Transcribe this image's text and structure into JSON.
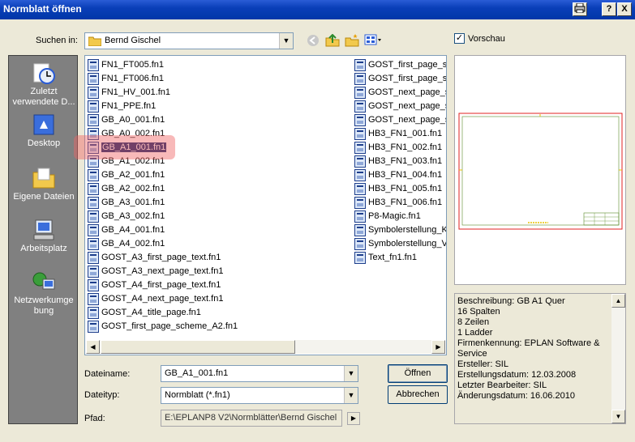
{
  "window": {
    "title": "Normblatt öffnen",
    "help_label": "?",
    "close_label": "X"
  },
  "lookin": {
    "label": "Suchen in:",
    "value": "Bernd Gischel"
  },
  "preview_checkbox": {
    "label": "Vorschau",
    "checked_mark": "✓"
  },
  "places": [
    {
      "label1": "Zuletzt",
      "label2": "verwendete D..."
    },
    {
      "label1": "Desktop",
      "label2": ""
    },
    {
      "label1": "Eigene Dateien",
      "label2": ""
    },
    {
      "label1": "Arbeitsplatz",
      "label2": ""
    },
    {
      "label1": "Netzwerkumge",
      "label2": "bung"
    }
  ],
  "files_col1": [
    "FN1_FT005.fn1",
    "FN1_FT006.fn1",
    "FN1_HV_001.fn1",
    "FN1_PPE.fn1",
    "GB_A0_001.fn1",
    "GB_A0_002.fn1",
    "GB_A1_001.fn1",
    "GB_A1_002.fn1",
    "GB_A2_001.fn1",
    "GB_A2_002.fn1",
    "GB_A3_001.fn1",
    "GB_A3_002.fn1",
    "GB_A4_001.fn1",
    "GB_A4_002.fn1",
    "GOST_A3_first_page_text.fn1",
    "GOST_A3_next_page_text.fn1",
    "GOST_A4_first_page_text.fn1",
    "GOST_A4_next_page_text.fn1",
    "GOST_A4_title_page.fn1",
    "GOST_first_page_scheme_A2.fn1"
  ],
  "files_col2": [
    "GOST_first_page_sc",
    "GOST_first_page_sc",
    "GOST_next_page_sc",
    "GOST_next_page_sc",
    "GOST_next_page_sc",
    "HB3_FN1_001.fn1",
    "HB3_FN1_002.fn1",
    "HB3_FN1_003.fn1",
    "HB3_FN1_004.fn1",
    "HB3_FN1_005.fn1",
    "HB3_FN1_006.fn1",
    "P8-Magic.fn1",
    "Symbolerstellung_Kle",
    "Symbolerstellung_Ve",
    "Text_fn1.fn1"
  ],
  "filename": {
    "label": "Dateiname:",
    "value": "GB_A1_001.fn1"
  },
  "filetype": {
    "label": "Dateityp:",
    "value": "Normblatt (*.fn1)"
  },
  "path": {
    "label": "Pfad:",
    "value": "E:\\EPLANP8 V2\\Normblätter\\Bernd Gischel"
  },
  "buttons": {
    "open": "Öffnen",
    "cancel": "Abbrechen"
  },
  "info_lines": [
    "Beschreibung: GB A1 Quer",
    "16 Spalten",
    "8 Zeilen",
    "1 Ladder",
    "Firmenkennung: EPLAN Software &",
    "Service",
    "Ersteller: SIL",
    "Erstellungsdatum: 12.03.2008",
    "Letzter Bearbeiter: SIL",
    "Änderungsdatum: 16.06.2010"
  ],
  "colors": {
    "titlebar": "#0A3FB8",
    "places_bg": "#808080",
    "highlight": "#F06464",
    "drawing_frame": "#E02020",
    "drawing_lines": "#5A8A2A"
  }
}
